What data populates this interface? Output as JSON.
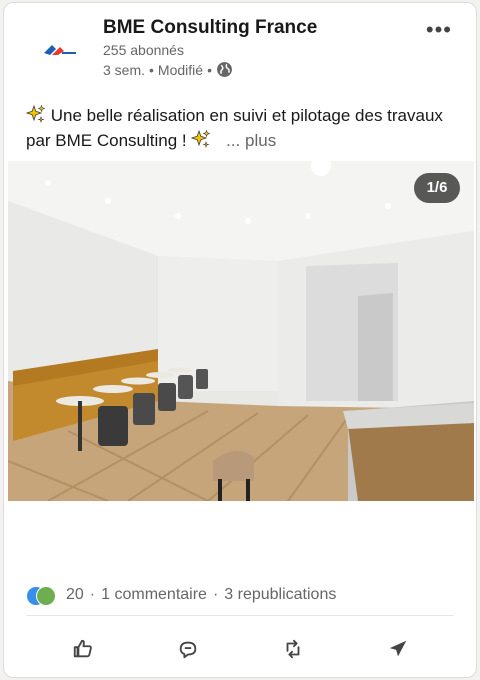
{
  "post": {
    "author": "BME Consulting France",
    "followers": "255 abonnés",
    "time": "3 sem.",
    "separator": "•",
    "edited": "Modifié",
    "separator2": "•",
    "text": "Une belle réalisation en suivi et pilotage des travaux par BME Consulting !",
    "see_more": "... plus"
  },
  "media": {
    "counter": "1/6"
  },
  "social": {
    "reactions": "20",
    "dot": "·",
    "comments": "1 commentaire",
    "dot2": "·",
    "reposts": "3 republications"
  },
  "colors": {
    "accent": "#0a66c2",
    "text_secondary": "#666666",
    "sparkle": "#f5c400"
  },
  "icons": {
    "more": "more-horizontal-icon",
    "visibility": "globe-icon",
    "like": "thumbs-up-icon",
    "comment": "comment-icon",
    "repost": "repost-icon",
    "send": "send-icon"
  }
}
